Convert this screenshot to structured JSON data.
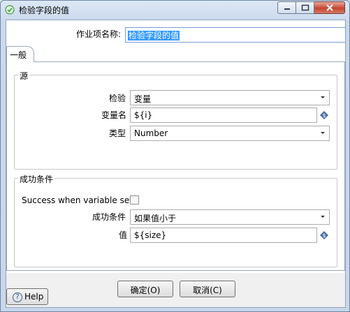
{
  "window": {
    "title": "检验字段的值",
    "icon": "check-circle-icon"
  },
  "form": {
    "name_label": "作业项名称:",
    "name_value": "检验字段的值"
  },
  "tab": {
    "label": "一般"
  },
  "source_group": {
    "title": "源",
    "check_label": "检验",
    "check_value": "变量",
    "varname_label": "变量名",
    "varname_value": "${i}",
    "type_label": "类型",
    "type_value": "Number"
  },
  "success_group": {
    "title": "成功条件",
    "success_when_set_label": "Success when variable set",
    "success_when_set_checked": false,
    "condition_label": "成功条件",
    "condition_value": "如果值小于",
    "value_label": "值",
    "value_value": "${size}"
  },
  "buttons": {
    "ok": "确定(O)",
    "cancel": "取消(C)",
    "help": "Help"
  },
  "colors": {
    "selection": "#3399ff",
    "variable_icon": "#4a6fa5",
    "title_icon": "#3c9b3c"
  }
}
